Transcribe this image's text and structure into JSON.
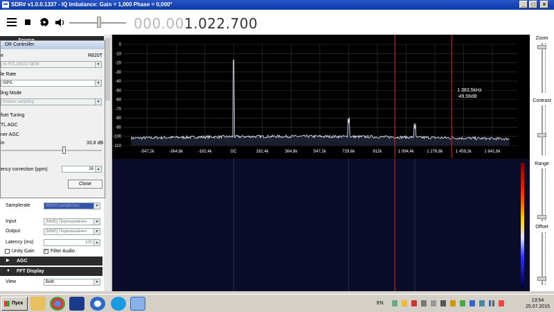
{
  "window": {
    "title": "SDR# v1.0.0.1337 - IQ Imbalance: Gain = 1,000 Phase = 0,000°",
    "minimize": "_",
    "maximize": "□",
    "close": "×"
  },
  "toolbar": {
    "menu_icon": "hamburger-icon",
    "stop_icon": "stop-icon",
    "settings_icon": "gear-icon",
    "audio_icon": "speaker-icon",
    "volume": 0.5,
    "frequency_dim": "000.00",
    "frequency_bright": "1.022.700"
  },
  "left_panel": {
    "source_header": "Source",
    "samplerate_label": "Samplerate",
    "samplerate_value": "48000 sample/sec",
    "input_label": "Input",
    "input_value": "[MME] Переназначен",
    "output_label": "Output",
    "output_value": "[MME] Переназначен",
    "latency_label": "Latency (ms)",
    "latency_value": "100",
    "unity_gain_label": "Unity Gain",
    "filter_audio_label": "Filter Audio",
    "agc_header": "AGC",
    "fft_header": "FFT Display",
    "view_label": "View",
    "view_value": "Both"
  },
  "rtl_dialog": {
    "title": "DR Controller",
    "device_label": "e",
    "device_model": "R820T",
    "device_value": "ric RTL2832U OEM",
    "sample_rate_label": "le Rate",
    "sample_rate_value": "ISPS",
    "sampling_mode_label": "ling Mode",
    "sampling_mode_value": "drature sampling",
    "offset_tuning_label": "fset Tuning",
    "rtl_agc_label": "TL AGC",
    "tuner_agc_label": "ner AGC",
    "gain_label": "in",
    "gain_value": "33,8 dB",
    "gain_level": 0.62,
    "ppm_label": "ency correction (ppm)",
    "ppm_value": "16",
    "close_button": "Close"
  },
  "right_panel": {
    "zoom_label": "Zoom",
    "contrast_label": "Contrast",
    "range_label": "Range",
    "offset_label": "Offset",
    "zoom_level": 0.05,
    "contrast_level": 0.6,
    "range_level": 0.95,
    "offset_level": 0.92
  },
  "chart_data": {
    "type": "line",
    "title": "",
    "xlabel": "",
    "ylabel": "",
    "x_tick_labels": [
      "-547,2k",
      "-364,8k",
      "-182,4k",
      "DC",
      "182,4k",
      "364,8k",
      "547,2k",
      "729,6k",
      "912k",
      "1 094,4k",
      "1 276,8k",
      "1 459,2k",
      "1 641,6k"
    ],
    "x_tick_values": [
      -547.2,
      -364.8,
      -182.4,
      0,
      182.4,
      364.8,
      547.2,
      729.6,
      912,
      1094.4,
      1276.8,
      1459.2,
      1641.6
    ],
    "xlim": [
      -700,
      1800
    ],
    "ylim": [
      -110,
      0
    ],
    "y_ticks": [
      0,
      -10,
      -20,
      -30,
      -40,
      -50,
      -60,
      -70,
      -80,
      -90,
      -100,
      -110
    ],
    "grid": true,
    "peaks": [
      {
        "x": 0,
        "y": -20
      },
      {
        "x": 729.6,
        "y": -86
      },
      {
        "x": 1150,
        "y": -92
      }
    ],
    "noise_floor": -102,
    "markers": [
      1022.7,
      1383.5
    ],
    "cursor": {
      "x": 1383.5,
      "y": -49.56
    },
    "cursor_freq": "1 383,5kHz",
    "cursor_level": "-49,56dB"
  },
  "taskbar": {
    "start_label": "Пуск",
    "language": "EN",
    "time": "13:54",
    "date": "25.07.2015"
  }
}
